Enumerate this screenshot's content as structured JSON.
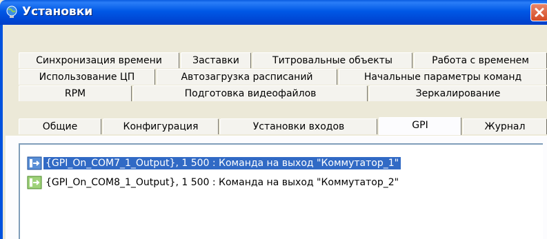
{
  "window": {
    "title": "Установки"
  },
  "tabs": {
    "row1": [
      "Синхронизация времени",
      "Заставки",
      "Титровальные объекты",
      "Работа с временем"
    ],
    "row2": [
      "Использование ЦП",
      "Автозагрузка расписаний",
      "Начальные параметры команд"
    ],
    "row3": [
      "RPM",
      "Подготовка видеофайлов",
      "Зеркалирование"
    ],
    "row4": [
      "Общие",
      "Конфигурация",
      "Установки входов",
      "GPI",
      "Журнал"
    ],
    "active": "GPI"
  },
  "gpi_list": [
    {
      "text": "{GPI_On_COM7_1_Output}, 1 500 : Команда на выход \"Коммутатор_1\"",
      "selected": true
    },
    {
      "text": "{GPI_On_COM8_1_Output}, 1 500 : Команда на выход \"Коммутатор_2\"",
      "selected": false
    }
  ],
  "colors": {
    "titlebar": "#0058e6",
    "selection": "#316ac5",
    "close_button": "#d44a23"
  },
  "icons": {
    "app": "globe-icon",
    "close": "close-icon",
    "gpi_item": "gpi-command-icon"
  }
}
